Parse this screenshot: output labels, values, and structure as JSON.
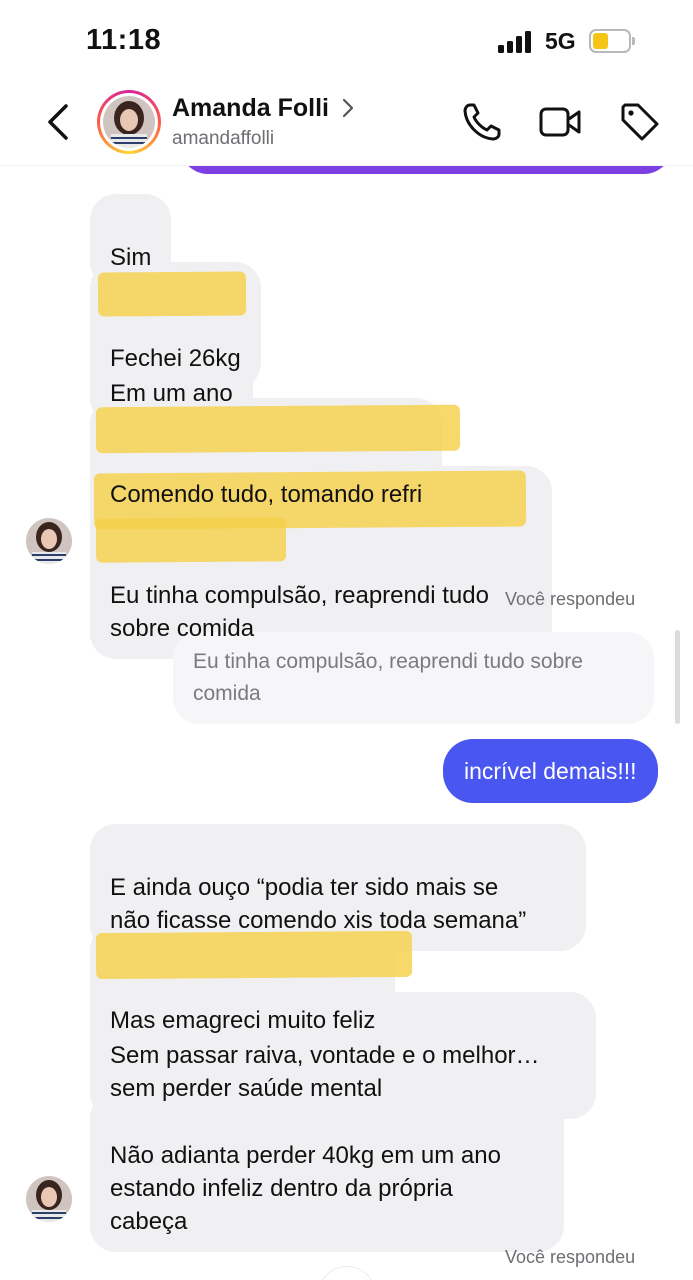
{
  "status_bar": {
    "time": "11:18",
    "network": "5G",
    "battery_level": 0.45,
    "battery_color": "#f5c518"
  },
  "header": {
    "name": "Amanda Folli",
    "handle": "amandaffolli",
    "icons": [
      "back-arrow-icon",
      "chevron-right-icon",
      "phone-icon",
      "video-camera-icon",
      "tag-icon"
    ]
  },
  "messages_received_1": [
    {
      "text": "Sim",
      "highlighted": false
    },
    {
      "text": "Fechei 26kg",
      "highlighted": true
    },
    {
      "text": "Em um ano",
      "highlighted": false
    },
    {
      "text": "Comendo tudo, tomando refri",
      "highlighted": true
    },
    {
      "text": "Eu tinha compulsão, reaprendi tudo\nsobre comida",
      "highlighted": true
    }
  ],
  "reply_1": {
    "label": "Você respondeu",
    "quote": "Eu tinha compulsão, reaprendi tudo sobre\ncomida",
    "message": "incrível demais!!!"
  },
  "messages_received_2": [
    {
      "text": "E ainda ouço “podia ter sido mais se\nnão ficasse comendo xis toda semana”",
      "highlighted": false
    },
    {
      "text": "Mas emagreci muito feliz",
      "highlighted": true
    },
    {
      "text": "Sem passar raiva, vontade e o melhor…\nsem perder saúde mental",
      "highlighted": false
    },
    {
      "text": "Não adianta perder 40kg em um ano\nestando infeliz dentro da própria\ncabeça",
      "highlighted": false
    }
  ],
  "reply_2": {
    "label": "Você respondeu"
  },
  "colors": {
    "sent_bubble": "#4a56f0",
    "received_bubble": "#f0f0f3",
    "highlight": "#f5d04a",
    "previous_bubble": "#7b3fe4"
  }
}
